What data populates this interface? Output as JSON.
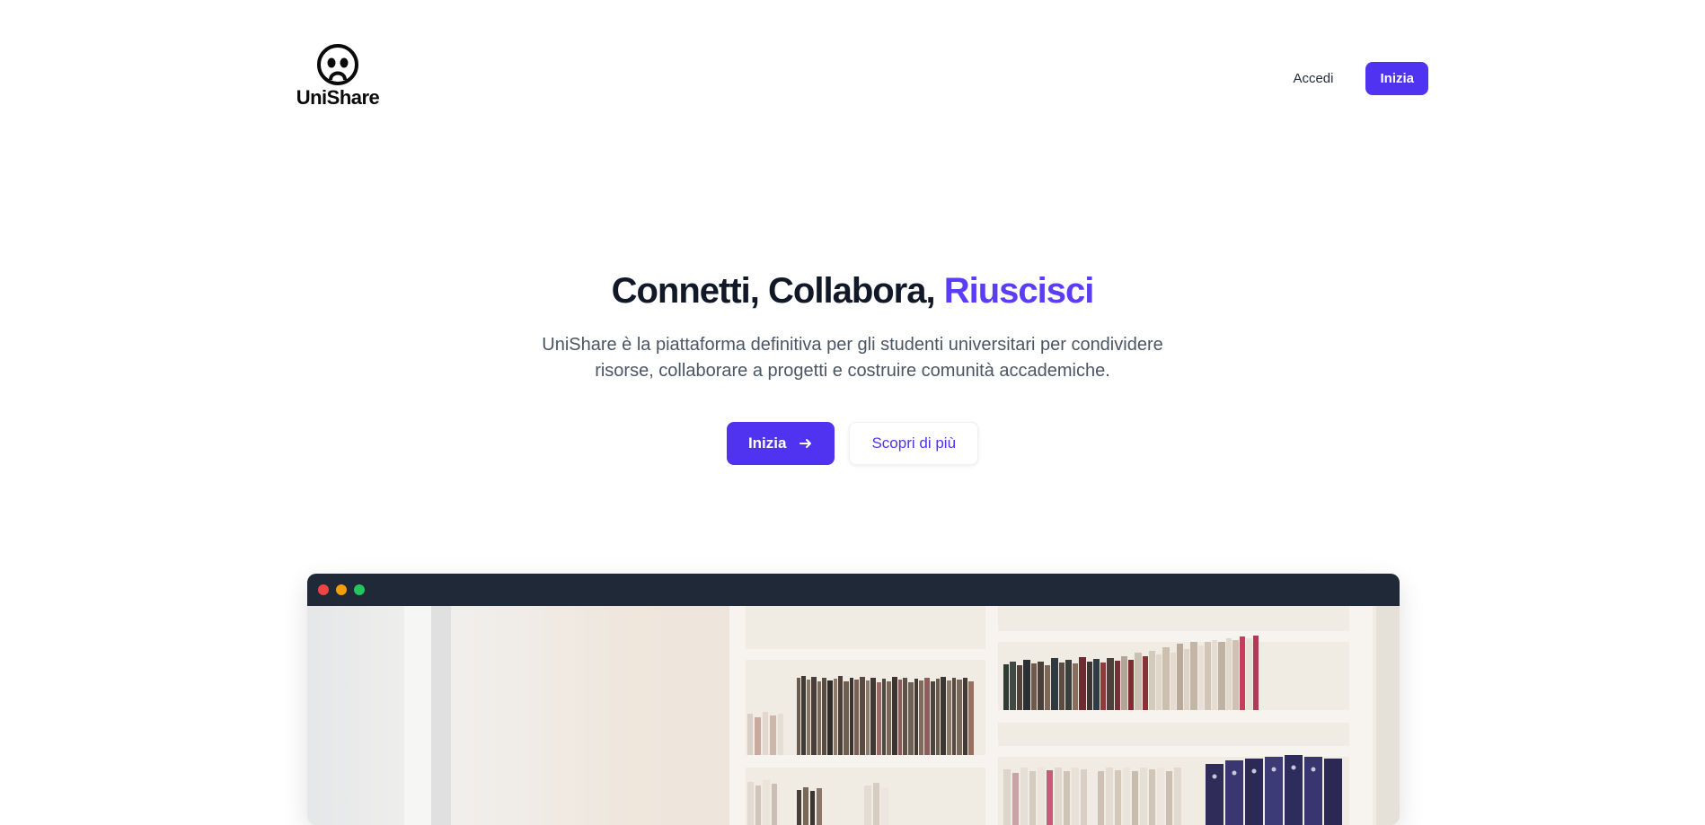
{
  "header": {
    "brand": "UniShare",
    "nav": {
      "login_label": "Accedi",
      "start_label": "Inizia"
    }
  },
  "hero": {
    "title_main": "Connetti, Collabora,",
    "title_accent": "Riuscisci",
    "subtitle": "UniShare è la piattaforma definitiva per gli studenti universitari per condividere risorse, collaborare a progetti e costruire comunità accademiche.",
    "primary_cta": "Inizia",
    "secondary_cta": "Scopri di più"
  },
  "icons": {
    "logo": "smiley-face-icon",
    "primary_cta": "arrow-right-icon",
    "window_controls": [
      "close-dot",
      "minimize-dot",
      "maximize-dot"
    ]
  },
  "colors": {
    "accent": "#4f33f0",
    "accent_text": "#5b3df5",
    "window_bar": "#1f2937",
    "dot_red": "#ef4444",
    "dot_yellow": "#f59e0b",
    "dot_green": "#22c55e"
  }
}
